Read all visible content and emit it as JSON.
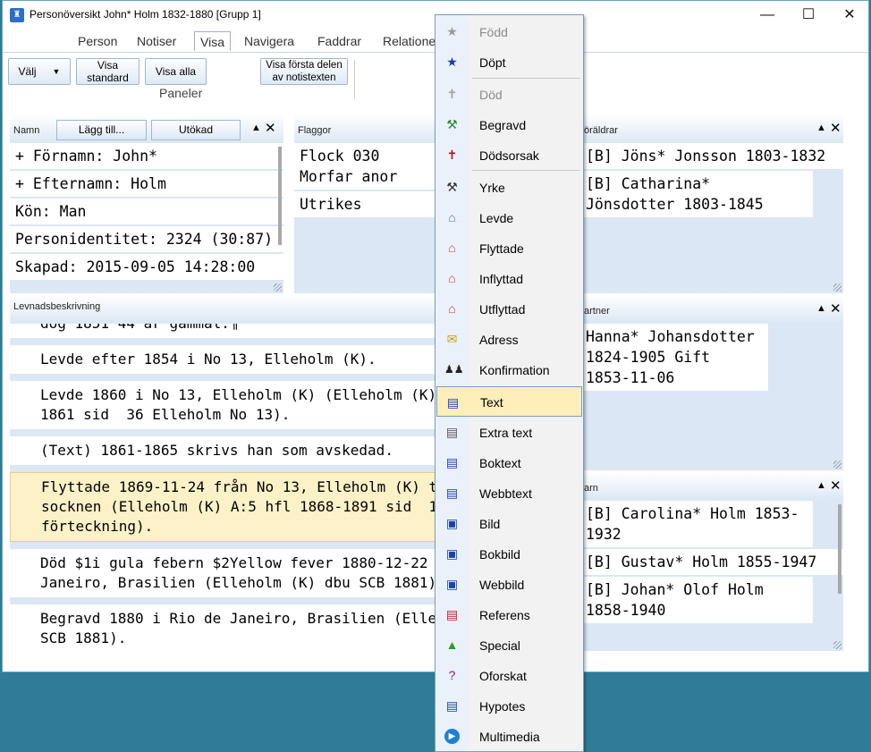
{
  "window": {
    "title": "Personöversikt John* Holm 1832-1880 [Grupp 1]",
    "minimize": "—",
    "maximize": "☐",
    "close": "✕"
  },
  "ribbon": {
    "tabs": [
      "Person",
      "Notiser",
      "Visa",
      "Navigera",
      "Faddrar",
      "Relatione"
    ],
    "buttons": {
      "valj": "Välj",
      "visa_standard": "Visa standard",
      "visa_alla": "Visa alla",
      "visa_forsta": "Visa första delen av notistexten"
    },
    "group_label": "Paneler"
  },
  "panels": {
    "namn": {
      "title": "Namn",
      "add": "Lägg till...",
      "extended": "Utökad",
      "rows": [
        "+ Förnamn:  John*",
        "+ Efternamn:  Holm",
        "Kön: Man",
        "Personidentitet: 2324 (30:87)",
        "Skapad:  2015-09-05  14:28:00"
      ]
    },
    "flaggor": {
      "title": "Flaggor",
      "rows": [
        "Flock 030 Morfar anor",
        "Utrikes"
      ]
    },
    "foraldrar": {
      "title": "öräldrar",
      "rows": [
        "[B] Jöns*  Jonsson  1803-1832",
        "[B] Catharina*  Jönsdotter 1803-1845"
      ]
    },
    "partner": {
      "title": "artner",
      "rows": [
        "Hanna*  Johansdotter 1824-1905 Gift  1853-11-06"
      ]
    },
    "barn": {
      "title": "arn",
      "rows": [
        "[B] Carolina*  Holm 1853-1932",
        "[B] Gustav*  Holm 1855-1947",
        "[B] Johan*  Olof Holm 1858-1940"
      ]
    },
    "levnad": {
      "title": "Levnadsbeskrivning",
      "partial": "dog 1851 44 år gammal.¶",
      "rows": [
        "Levde efter 1854 i No 13, Elleholm (K).",
        "Levde 1860 i No 13, Elleholm (K) (Elleholm (K)\n1861 sid  36 Elleholm No 13).",
        "(Text) 1861-1865 skrivs han som avskedad.",
        "Flyttade 1869-11-24 från No 13, Elleholm (K) til\nsocknen (Elleholm (K) A:5 hfl 1868-1891 sid  13\nförteckning).",
        "Död $1i gula febern $2Yellow fever 1880-12-22\nJaneiro, Brasilien (Elleholm (K) dbu SCB 1881).",
        "Begravd 1880 i Rio de Janeiro, Brasilien (Elleho\nSCB 1881)."
      ]
    }
  },
  "menu": {
    "items": [
      {
        "label": "Född",
        "icon": "star-icon",
        "disabled": true
      },
      {
        "label": "Döpt",
        "icon": "star-icon"
      },
      {
        "label": "Död",
        "icon": "cross-icon",
        "disabled": true
      },
      {
        "label": "Begravd",
        "icon": "shovel-icon"
      },
      {
        "label": "Dödsorsak",
        "icon": "cross-red-icon"
      },
      {
        "label": "Yrke",
        "icon": "hammer-icon"
      },
      {
        "label": "Levde",
        "icon": "house-icon"
      },
      {
        "label": "Flyttade",
        "icon": "house-move-icon"
      },
      {
        "label": "Inflyttad",
        "icon": "house-in-icon"
      },
      {
        "label": "Utflyttad",
        "icon": "house-out-icon"
      },
      {
        "label": "Adress",
        "icon": "envelope-icon"
      },
      {
        "label": "Konfirmation",
        "icon": "people-icon"
      },
      {
        "label": "Text",
        "icon": "text-doc-icon",
        "highlight": true
      },
      {
        "label": "Extra text",
        "icon": "extra-text-icon"
      },
      {
        "label": "Boktext",
        "icon": "book-text-icon"
      },
      {
        "label": "Webbtext",
        "icon": "web-text-icon"
      },
      {
        "label": "Bild",
        "icon": "image-icon"
      },
      {
        "label": "Bokbild",
        "icon": "book-image-icon"
      },
      {
        "label": "Webbild",
        "icon": "web-image-icon"
      },
      {
        "label": "Referens",
        "icon": "reference-icon"
      },
      {
        "label": "Special",
        "icon": "warning-icon"
      },
      {
        "label": "Oforskat",
        "icon": "question-icon"
      },
      {
        "label": "Hypotes",
        "icon": "hypothesis-icon"
      },
      {
        "label": "Multimedia",
        "icon": "play-icon"
      }
    ]
  },
  "colors": {
    "accent_blue": "#2b6fc8",
    "highlight": "#fdeeba",
    "panel_bg": "#dbe7f5",
    "taskbar": "#2e7c97"
  }
}
